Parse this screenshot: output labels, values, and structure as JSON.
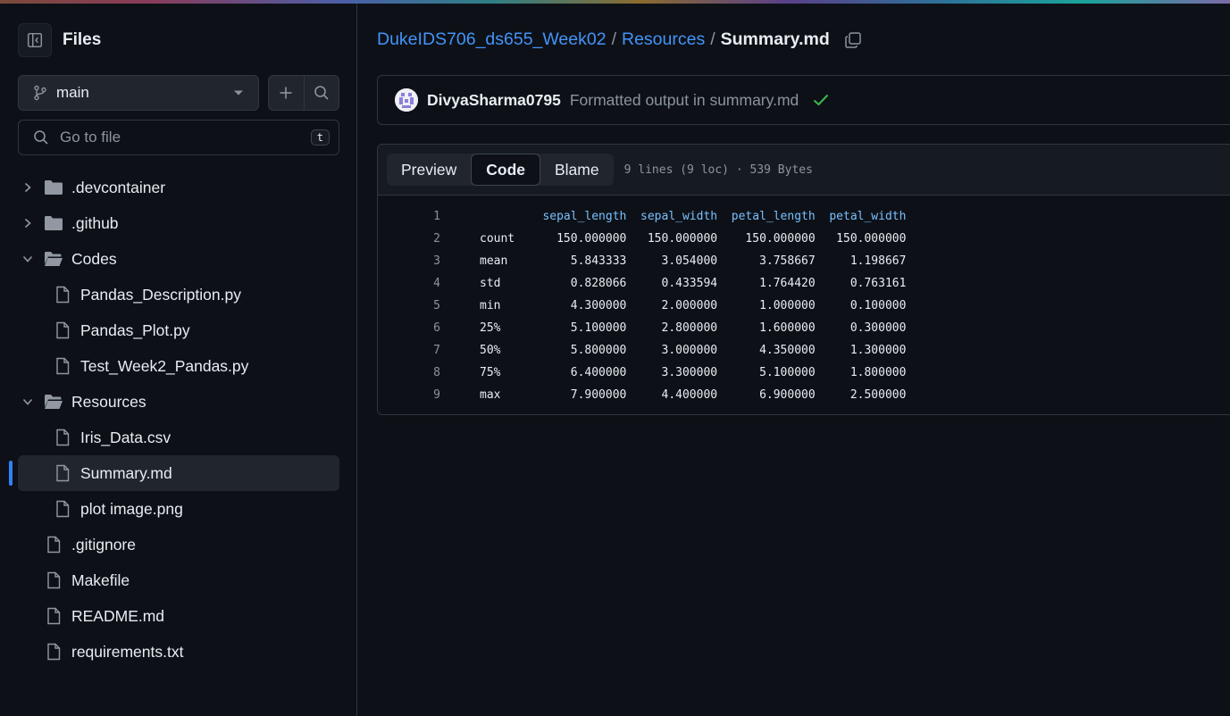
{
  "sidebar": {
    "title": "Files",
    "branch": "main",
    "goto_placeholder": "Go to file",
    "goto_shortcut": "t",
    "tree": [
      {
        "label": ".devcontainer",
        "type": "folder",
        "expanded": false,
        "depth": 0
      },
      {
        "label": ".github",
        "type": "folder",
        "expanded": false,
        "depth": 0
      },
      {
        "label": "Codes",
        "type": "folder",
        "expanded": true,
        "depth": 0
      },
      {
        "label": "Pandas_Description.py",
        "type": "file",
        "depth": 1
      },
      {
        "label": "Pandas_Plot.py",
        "type": "file",
        "depth": 1
      },
      {
        "label": "Test_Week2_Pandas.py",
        "type": "file",
        "depth": 1
      },
      {
        "label": "Resources",
        "type": "folder",
        "expanded": true,
        "depth": 0
      },
      {
        "label": "Iris_Data.csv",
        "type": "file",
        "depth": 1
      },
      {
        "label": "Summary.md",
        "type": "file",
        "depth": 1,
        "selected": true
      },
      {
        "label": "plot image.png",
        "type": "file",
        "depth": 1
      },
      {
        "label": ".gitignore",
        "type": "file",
        "depth": 0
      },
      {
        "label": "Makefile",
        "type": "file",
        "depth": 0
      },
      {
        "label": "README.md",
        "type": "file",
        "depth": 0
      },
      {
        "label": "requirements.txt",
        "type": "file",
        "depth": 0
      }
    ]
  },
  "breadcrumb": {
    "repo": "DukeIDS706_ds655_Week02",
    "folder": "Resources",
    "file": "Summary.md",
    "separator": "/"
  },
  "commit": {
    "author": "DivyaSharma0795",
    "message": "Formatted output in summary.md",
    "status": "success"
  },
  "viewer": {
    "tabs": [
      "Preview",
      "Code",
      "Blame"
    ],
    "active_tab": "Code",
    "file_info": "9 lines (9 loc) · 539 Bytes"
  },
  "code_lines": [
    {
      "n": "1",
      "text": "         sepal_length  sepal_width  petal_length  petal_width"
    },
    {
      "n": "2",
      "text": "count      150.000000   150.000000    150.000000   150.000000"
    },
    {
      "n": "3",
      "text": "mean         5.843333     3.054000      3.758667     1.198667"
    },
    {
      "n": "4",
      "text": "std          0.828066     0.433594      1.764420     0.763161"
    },
    {
      "n": "5",
      "text": "min          4.300000     2.000000      1.000000     0.100000"
    },
    {
      "n": "6",
      "text": "25%          5.100000     2.800000      1.600000     0.300000"
    },
    {
      "n": "7",
      "text": "50%          5.800000     3.000000      4.350000     1.300000"
    },
    {
      "n": "8",
      "text": "75%          6.400000     3.300000      5.100000     1.800000"
    },
    {
      "n": "9",
      "text": "max          7.900000     4.400000      6.900000     2.500000"
    }
  ],
  "colors": {
    "link": "#4493f8",
    "success": "#3fb950",
    "selected_indicator": "#2f81f7"
  }
}
